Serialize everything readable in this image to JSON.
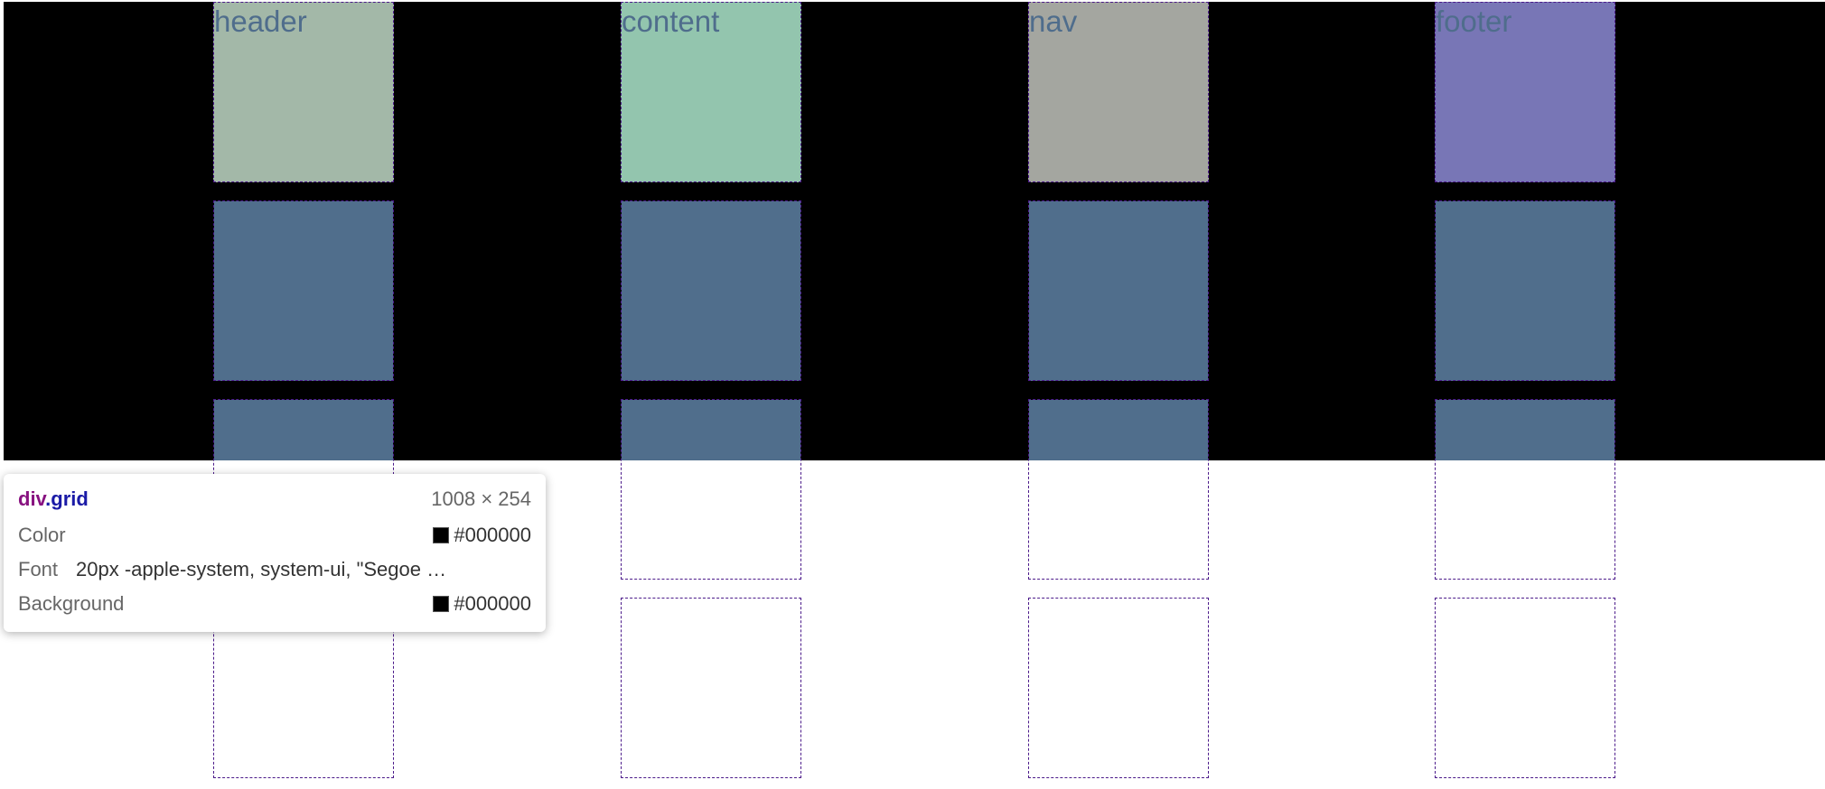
{
  "grid": {
    "areas": [
      {
        "label": "header",
        "color": "#a3b8a8"
      },
      {
        "label": "content",
        "color": "#93c5ae"
      },
      {
        "label": "nav",
        "color": "#a4a6a0"
      },
      {
        "label": "footer",
        "color": "#7876b6"
      }
    ],
    "filled_color": "#506e8c",
    "border_color": "#4b1a8a"
  },
  "tooltip": {
    "tag": "div",
    "class": ".grid",
    "size": "1008 × 254",
    "rows": [
      {
        "key": "Color",
        "value": "#000000",
        "swatch": "#000000"
      },
      {
        "key": "Font",
        "value": "20px -apple-system, system-ui, \"Segoe …"
      },
      {
        "key": "Background",
        "value": "#000000",
        "swatch": "#000000"
      }
    ]
  }
}
